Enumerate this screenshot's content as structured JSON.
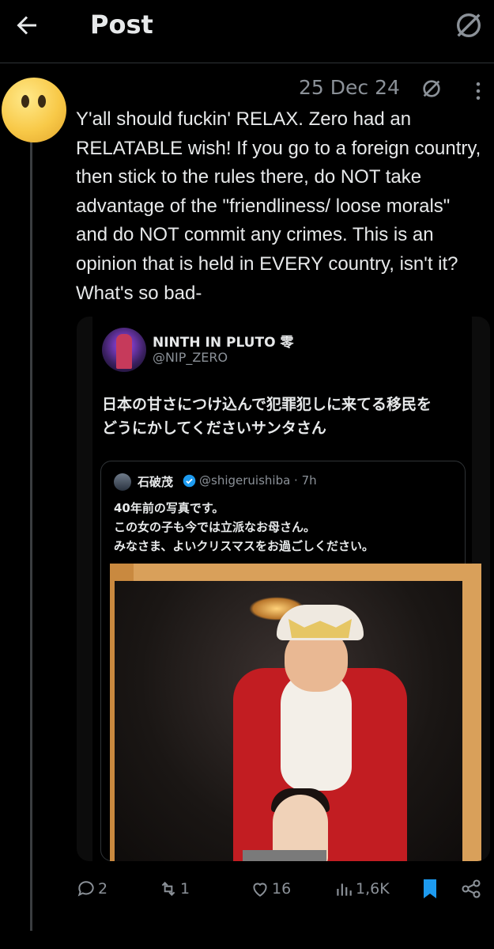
{
  "header": {
    "title": "Post"
  },
  "post": {
    "date": "25 Dec 24",
    "text": "Y'all should fuckin' RELAX. Zero had an RELATABLE wish! If you go to a foreign country, then stick to the rules there, do NOT take advantage of the \"friendliness/ loose morals\" and do NOT commit any crimes. This is an opinion that is held in EVERY country, isn't it? What's so bad-"
  },
  "quoted": {
    "name": "NINTH IN PLUTO 零",
    "handle": "@NIP_ZERO",
    "text": "日本の甘さにつけ込んで犯罪犯しに来てる移民を\nどうにかしてくださいサンタさん",
    "inner": {
      "name": "石破茂",
      "handle": "@shigeruishiba · 7h",
      "text": "40年前の写真です。\nこの女の子も今では立派なお母さん。\nみなさま、よいクリスマスをお過ごしください。"
    }
  },
  "actions": {
    "replies": "2",
    "reposts": "1",
    "likes": "16",
    "views": "1,6K"
  },
  "colors": {
    "accent": "#1d9bf0",
    "muted": "#8b9198"
  },
  "icons": [
    "back-arrow-icon",
    "grok-icon",
    "more-icon",
    "reply-icon",
    "repost-icon",
    "like-icon",
    "views-icon",
    "bookmark-icon",
    "share-icon",
    "verified-badge-icon"
  ]
}
